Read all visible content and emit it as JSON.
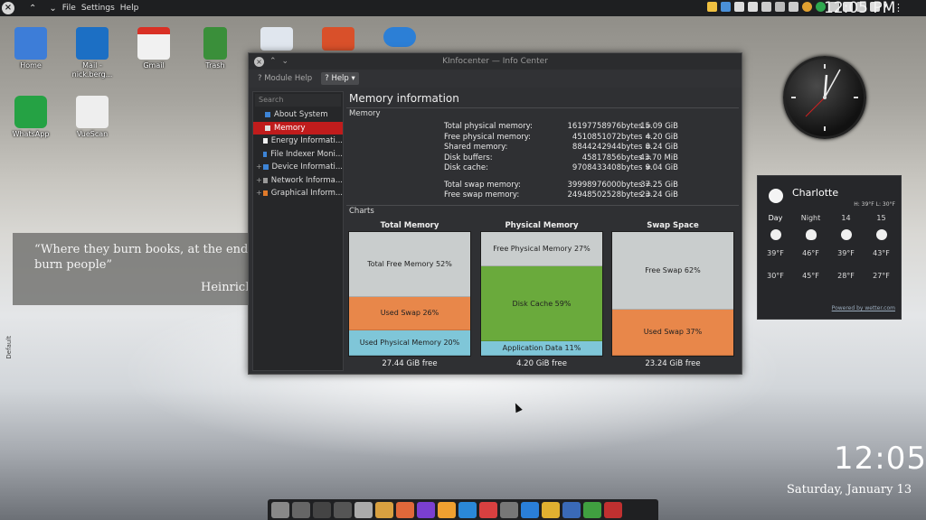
{
  "topbar": {
    "menus": [
      "File",
      "Settings",
      "Help"
    ],
    "time": "12:05 PM"
  },
  "desktop_icons": [
    {
      "label": "Home",
      "color": "#3d7dd8"
    },
    {
      "label": "Mail - nick.berg...",
      "color": "#1c6fc4"
    },
    {
      "label": "Gmail",
      "color": "#f1f1f1"
    },
    {
      "label": "Trash",
      "color": "#3a8f3a"
    },
    {
      "label": "",
      "color": "#e0e6ee"
    },
    {
      "label": "",
      "color": "#d9502a"
    },
    {
      "label": "",
      "color": "#2c7fd6"
    },
    {
      "label": "WhatsApp",
      "color": "#25a244"
    },
    {
      "label": "VueScan",
      "color": "#eeeeee"
    }
  ],
  "quote": {
    "line1": "“Where they burn books, at the end they",
    "line2": "burn people”",
    "author": "Heinrich"
  },
  "side_label": "Default",
  "window": {
    "title": "KInfocenter — Info Center",
    "toolbar": {
      "module_help": "Module Help",
      "help": "Help"
    },
    "search_placeholder": "Search",
    "nav": [
      {
        "label": "About System",
        "expandable": false,
        "color": "#3d84d6"
      },
      {
        "label": "Memory",
        "expandable": false,
        "color": "#e0e0e0",
        "active": true
      },
      {
        "label": "Energy Informati...",
        "expandable": false,
        "color": "#f0f0f0"
      },
      {
        "label": "File Indexer Moni...",
        "expandable": false,
        "color": "#3d84d6"
      },
      {
        "label": "Device Informati...",
        "expandable": true,
        "color": "#3d84d6"
      },
      {
        "label": "Network Informa...",
        "expandable": true,
        "color": "#999999"
      },
      {
        "label": "Graphical Inform...",
        "expandable": true,
        "color": "#e07a2a"
      }
    ],
    "heading": "Memory information",
    "memory_group": "Memory",
    "memory_rows": [
      {
        "k": "Total physical memory:",
        "v": "16197758976",
        "u": "bytes =",
        "g": "15.09 GiB"
      },
      {
        "k": "Free physical memory:",
        "v": "4510851072",
        "u": "bytes =",
        "g": "4.20 GiB"
      },
      {
        "k": "Shared memory:",
        "v": "8844242944",
        "u": "bytes =",
        "g": "8.24 GiB"
      },
      {
        "k": "Disk buffers:",
        "v": "45817856",
        "u": "bytes =",
        "g": "43.70 MiB"
      },
      {
        "k": "Disk cache:",
        "v": "9708433408",
        "u": "bytes =",
        "g": "9.04 GiB"
      },
      {
        "k": "Total swap memory:",
        "v": "39998976000",
        "u": "bytes =",
        "g": "37.25 GiB"
      },
      {
        "k": "Free swap memory:",
        "v": "24948502528",
        "u": "bytes =",
        "g": "23.24 GiB"
      }
    ],
    "charts_group": "Charts"
  },
  "chart_data": [
    {
      "type": "bar",
      "title": "Total Memory",
      "segments": [
        {
          "label": "Total Free Memory 52%",
          "value": 52,
          "color": "#c9cdcd"
        },
        {
          "label": "Used Swap 26%",
          "value": 26,
          "color": "#e8874a"
        },
        {
          "label": "Used Physical Memory 20%",
          "value": 20,
          "color": "#7fc6d8"
        }
      ],
      "footer": "27.44 GiB free"
    },
    {
      "type": "bar",
      "title": "Physical Memory",
      "segments": [
        {
          "label": "Free Physical Memory 27%",
          "value": 27,
          "color": "#c9cdcd"
        },
        {
          "label": "Disk Cache 59%",
          "value": 59,
          "color": "#6aaa3c"
        },
        {
          "label": "Application Data 11%",
          "value": 11,
          "color": "#7fc6d8"
        }
      ],
      "footer": "4.20 GiB free"
    },
    {
      "type": "bar",
      "title": "Swap Space",
      "segments": [
        {
          "label": "Free Swap 62%",
          "value": 62,
          "color": "#c9cdcd"
        },
        {
          "label": "Used Swap 37%",
          "value": 37,
          "color": "#e8874a"
        }
      ],
      "footer": "23.24 GiB free"
    }
  ],
  "weather": {
    "city": "Charlotte",
    "hilo": "H: 39°F L: 30°F",
    "days": [
      "Day",
      "Night",
      "14",
      "15"
    ],
    "highs": [
      "39°F",
      "46°F",
      "39°F",
      "43°F"
    ],
    "lows": [
      "30°F",
      "45°F",
      "28°F",
      "27°F"
    ],
    "powered": "Powered by wetter.com"
  },
  "bottom_clock": {
    "time": "12:05",
    "date": "Saturday, January 13"
  },
  "dock_colors": [
    "#888",
    "#666",
    "#444",
    "#555",
    "#aaa",
    "#d8a040",
    "#e0683a",
    "#7a3fd0",
    "#f0a030",
    "#2a88d8",
    "#d84040",
    "#777",
    "#2a7fd8",
    "#e0b030",
    "#3a6ab8",
    "#40a040",
    "#c03030"
  ]
}
